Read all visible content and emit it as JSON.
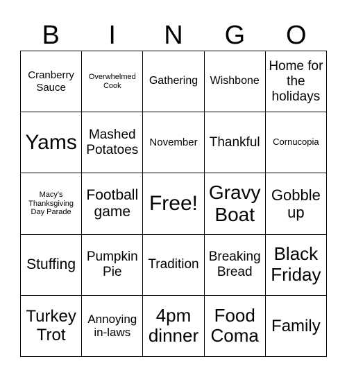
{
  "header": [
    "B",
    "I",
    "N",
    "G",
    "O"
  ],
  "cells": [
    "Cranberry Sauce",
    "Overwhelmed Cook",
    "Gathering",
    "Wishbone",
    "Home for the holidays",
    "Yams",
    "Mashed Potatoes",
    "November",
    "Thankful",
    "Cornucopia",
    "Macy's Thanksgiving Day Parade",
    "Football game",
    "Free!",
    "Gravy Boat",
    "Gobble up",
    "Stuffing",
    "Pumpkin Pie",
    "Tradition",
    "Breaking Bread",
    "Black Friday",
    "Turkey Trot",
    "Annoying in-laws",
    "4pm dinner",
    "Food Coma",
    "Family"
  ]
}
